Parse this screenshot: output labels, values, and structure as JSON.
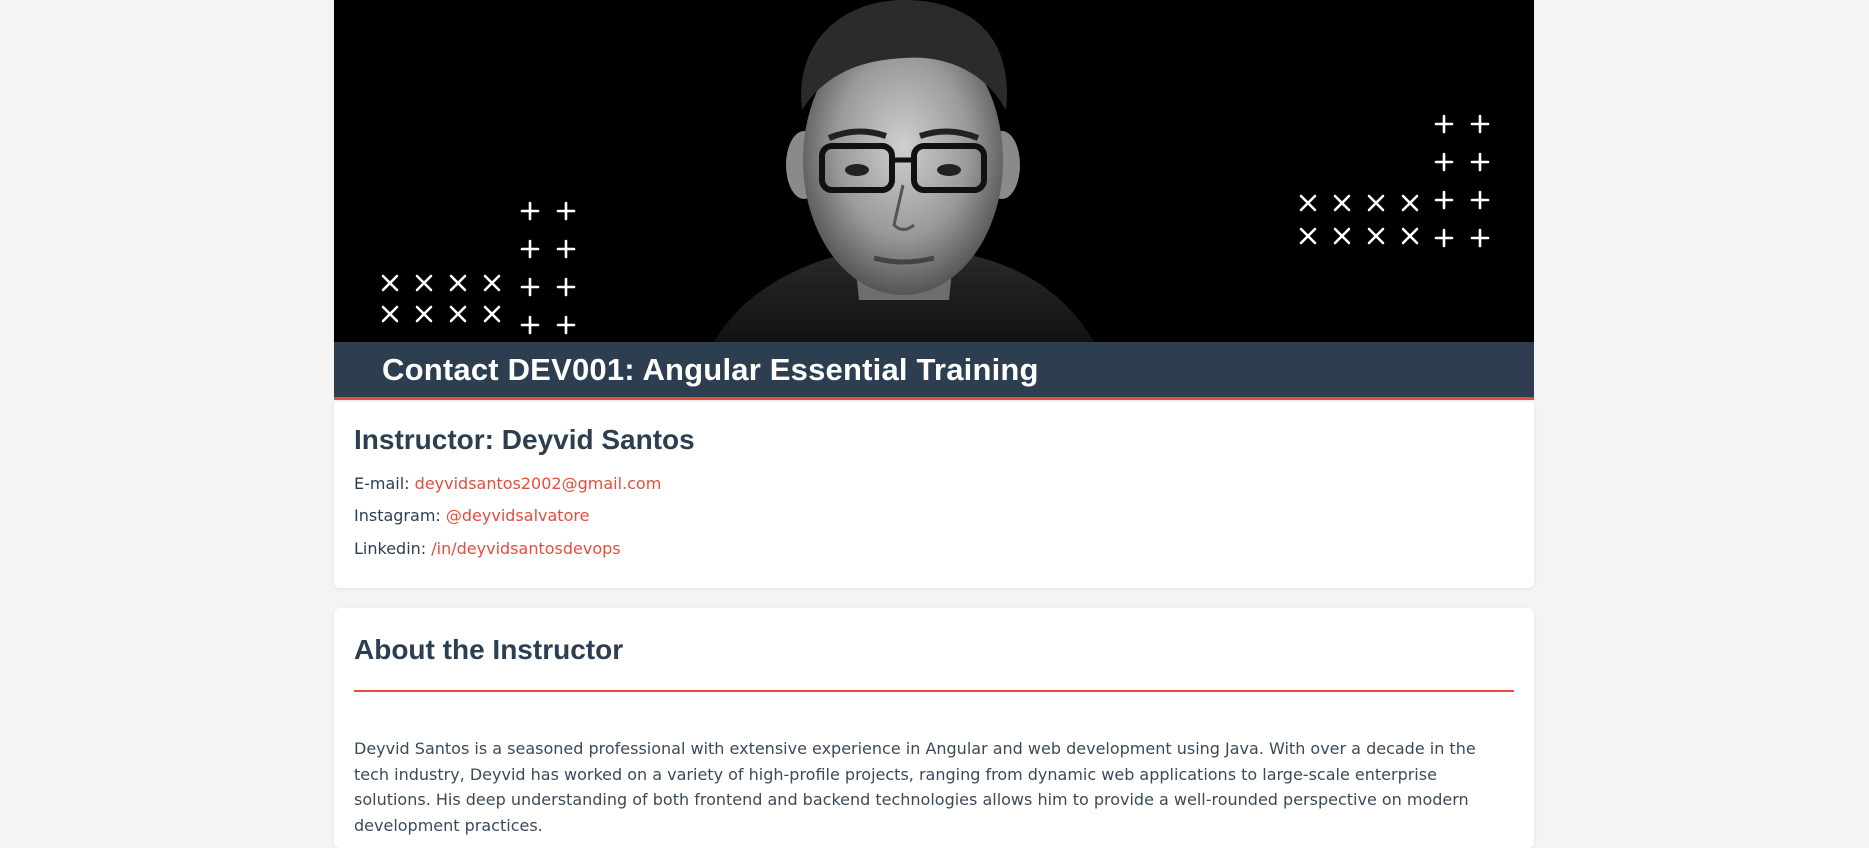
{
  "hero": {
    "title": "Contact DEV001: Angular Essential Training",
    "image": "instructor-portrait"
  },
  "contact": {
    "heading": "Instructor: Deyvid Santos",
    "email_label": "E-mail:",
    "email_value": "deyvidsantos2002@gmail.com",
    "instagram_label": "Instagram:",
    "instagram_value": "@deyvidsalvatore",
    "linkedin_label": "Linkedin:",
    "linkedin_value": "/in/deyvidsantosdevops"
  },
  "about": {
    "heading": "About the Instructor",
    "body": "Deyvid Santos is a seasoned professional with extensive experience in Angular and web development using Java. With over a decade in the tech industry, Deyvid has worked on a variety of high-profile projects, ranging from dynamic web applications to large-scale enterprise solutions. His deep understanding of both frontend and backend technologies allows him to provide a well-rounded perspective on modern development practices."
  },
  "colors": {
    "accent": "#e74c3c",
    "navy": "#2c3e50",
    "page_bg": "#f4f4f4"
  }
}
